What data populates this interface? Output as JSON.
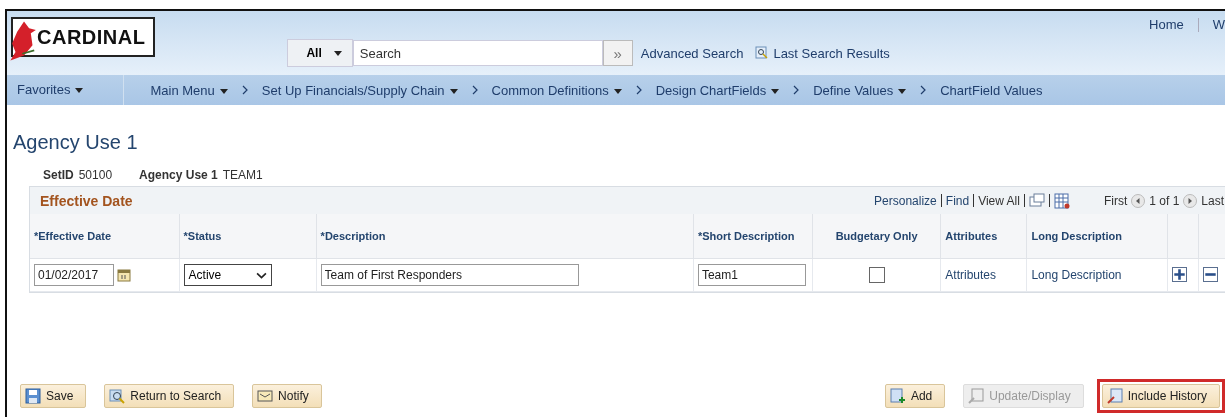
{
  "header": {
    "logo": "CARDINAL",
    "search_scope": "All",
    "search": {
      "placeholder": "Search"
    },
    "search_button": "»",
    "links": [
      {
        "label": "Advanced Search",
        "kind": "plain"
      },
      {
        "label": "Last Search Results",
        "kind": "icon"
      }
    ],
    "top_links": [
      "Home",
      "W"
    ]
  },
  "nav": {
    "items": [
      {
        "label": "Favorites",
        "kind": "root"
      },
      {
        "label": "Main Menu",
        "kind": "root"
      },
      {
        "label": "Set Up Financials/Supply Chain",
        "kind": "menu"
      },
      {
        "label": "Common Definitions",
        "kind": "menu"
      },
      {
        "label": "Design ChartFields",
        "kind": "menu"
      },
      {
        "label": "Define Values",
        "kind": "menu"
      },
      {
        "label": "ChartField Values",
        "kind": "page"
      }
    ]
  },
  "page_title": "Agency Use 1",
  "keys": [
    {
      "label": "SetID",
      "value": "50100"
    },
    {
      "label": "Agency Use 1",
      "value": "TEAM1"
    }
  ],
  "grid": {
    "title": "Effective Date",
    "tools": [
      "Personalize",
      "Find",
      "View All"
    ],
    "nav": {
      "first": "First",
      "count": "1 of 1",
      "last": "Last"
    },
    "columns": [
      "*Effective Date",
      "*Status",
      "*Description",
      "*Short Description",
      "Budgetary Only",
      "Attributes",
      "Long Description"
    ],
    "rows": [
      {
        "effective_date": "01/02/2017",
        "status": "Active",
        "description": "Team of First Responders",
        "short_description": "Team1",
        "budgetary_only": false,
        "attributes": "Attributes",
        "long_description": "Long Description"
      }
    ]
  },
  "buttons_left": [
    {
      "label": "Save",
      "disabled": false,
      "highlighted": false
    },
    {
      "label": "Return to Search",
      "disabled": false,
      "highlighted": false
    },
    {
      "label": "Notify",
      "disabled": false,
      "highlighted": false
    }
  ],
  "buttons_right": [
    {
      "label": "Add",
      "disabled": false,
      "highlighted": false
    },
    {
      "label": "Update/Display",
      "disabled": true,
      "highlighted": false
    },
    {
      "label": "Include History",
      "disabled": false,
      "highlighted": true
    }
  ]
}
